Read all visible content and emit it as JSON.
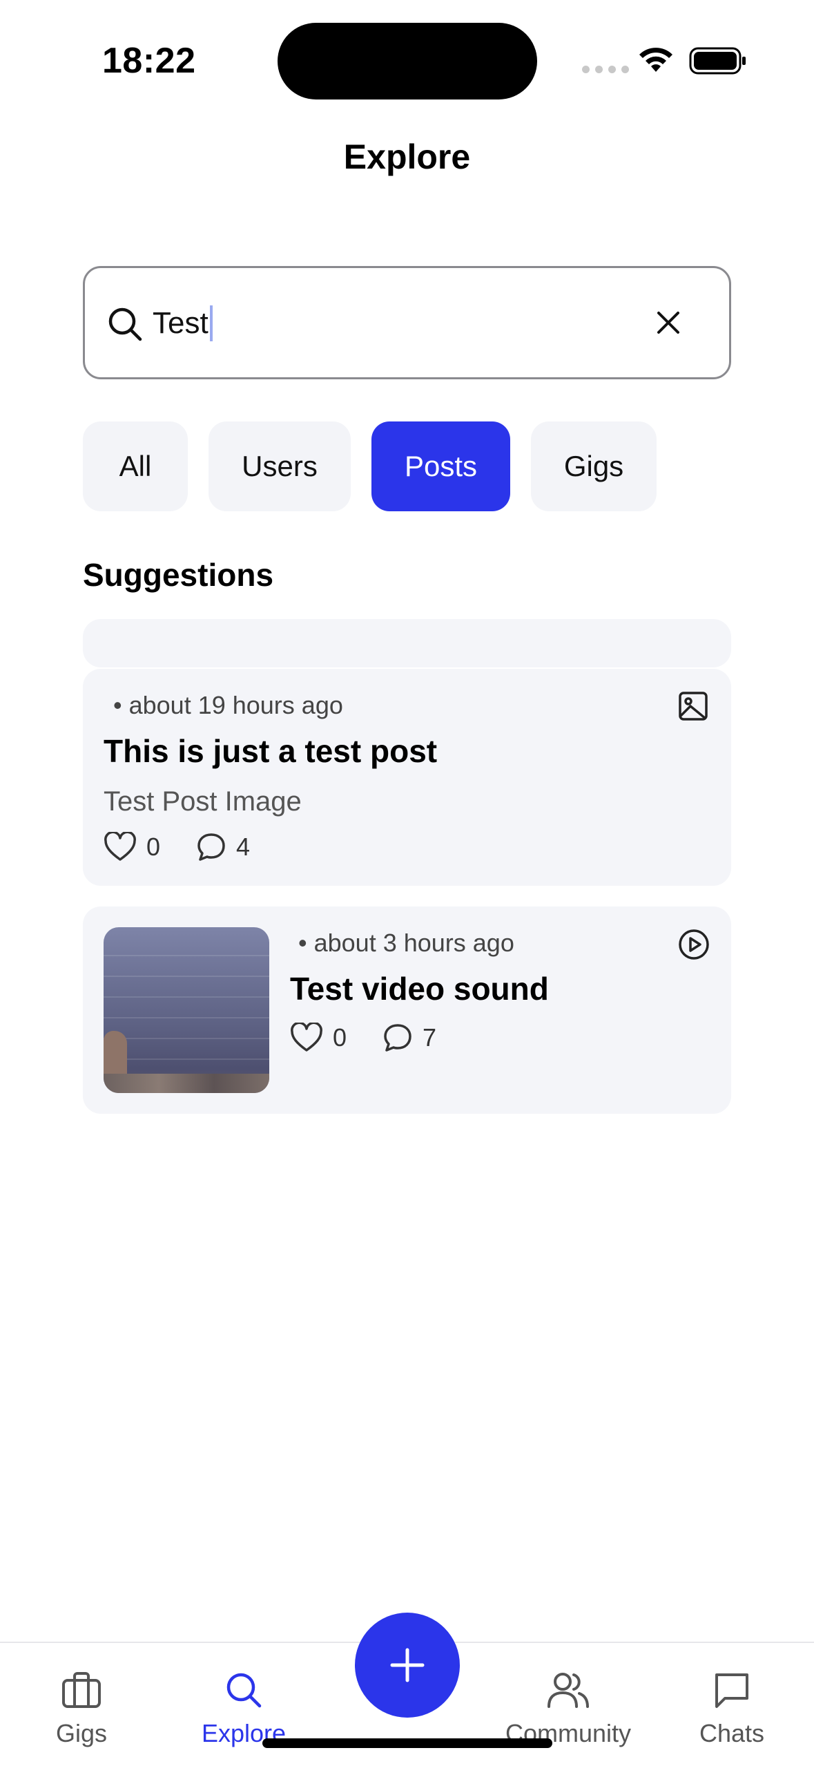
{
  "status_bar": {
    "time": "18:22"
  },
  "header": {
    "title": "Explore"
  },
  "search": {
    "value": "Test"
  },
  "filters": [
    {
      "label": "All",
      "active": false
    },
    {
      "label": "Users",
      "active": false
    },
    {
      "label": "Posts",
      "active": true
    },
    {
      "label": "Gigs",
      "active": false
    }
  ],
  "suggestions": {
    "title": "Suggestions",
    "posts": [
      {
        "time": "• about 19 hours ago",
        "title": "This is just a test post",
        "subtitle": "Test Post Image",
        "likes": "0",
        "comments": "4",
        "type_icon": "image-icon"
      },
      {
        "time": "• about 3 hours ago",
        "title": "Test video sound",
        "likes": "0",
        "comments": "7",
        "type_icon": "play-circle-icon"
      }
    ]
  },
  "tabbar": {
    "items": [
      {
        "label": "Gigs",
        "icon": "briefcase-icon",
        "active": false
      },
      {
        "label": "Explore",
        "icon": "search-icon",
        "active": true
      },
      {
        "label": "Community",
        "icon": "users-icon",
        "active": false
      },
      {
        "label": "Chats",
        "icon": "chat-icon",
        "active": false
      }
    ],
    "fab_icon": "plus-icon"
  },
  "colors": {
    "accent": "#2b35ea",
    "card_bg": "#f4f5f9",
    "chip_bg": "#f3f4f8"
  }
}
